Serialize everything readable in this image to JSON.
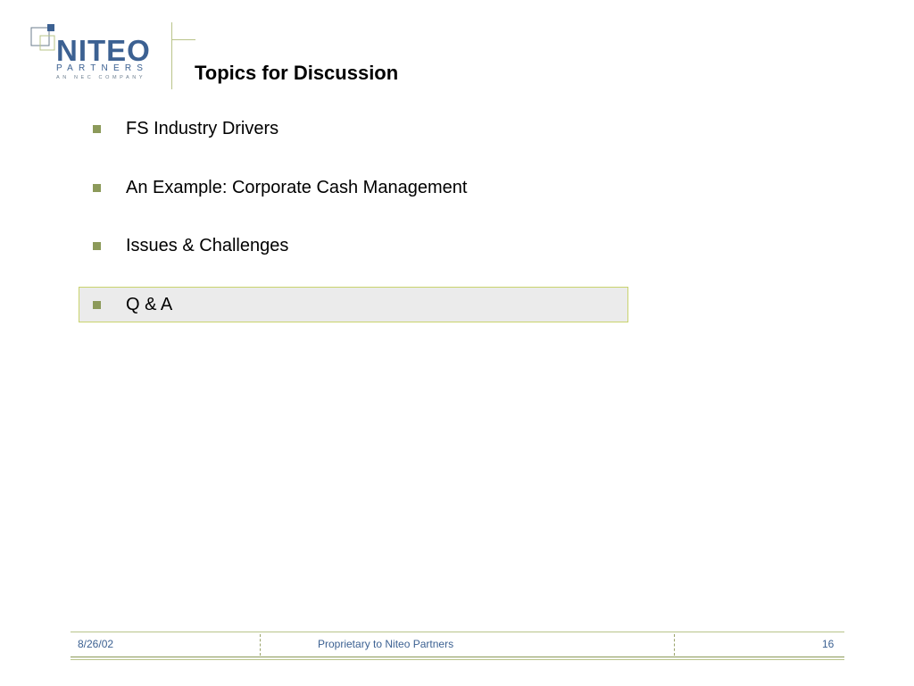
{
  "logo": {
    "wordmark": "NITEO",
    "partners": "PARTNERS",
    "tagline": "AN NEC COMPANY"
  },
  "slide": {
    "title": "Topics for Discussion",
    "bullets": [
      "FS Industry Drivers",
      "An Example: Corporate Cash Management",
      "Issues & Challenges",
      "Q & A"
    ],
    "highlighted_index": 3
  },
  "footer": {
    "date": "8/26/02",
    "proprietary": "Proprietary to Niteo Partners",
    "page_number": "16"
  },
  "colors": {
    "brand_blue": "#3c6192",
    "accent_olive": "#8c9a5a",
    "highlight_bg": "#ebebeb",
    "highlight_border": "#c9d36e"
  }
}
